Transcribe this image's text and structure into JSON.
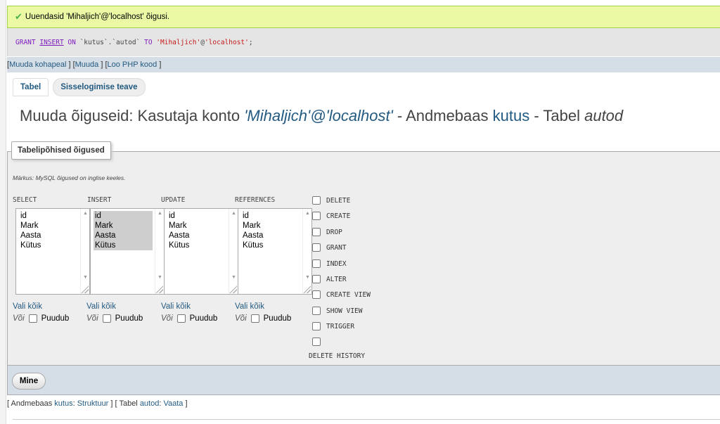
{
  "success_message": "Uuendasid 'Mihaljich'@'localhost' õigusi.",
  "sql": {
    "parts": [
      {
        "t": "GRANT",
        "c": "kw"
      },
      {
        "t": " ",
        "c": "plain"
      },
      {
        "t": "INSERT",
        "c": "kw u"
      },
      {
        "t": " ",
        "c": "plain"
      },
      {
        "t": "ON",
        "c": "kw"
      },
      {
        "t": " `kutus`.`autod` ",
        "c": "plain"
      },
      {
        "t": "TO",
        "c": "kw"
      },
      {
        "t": " ",
        "c": "plain"
      },
      {
        "t": "'Mihaljich'",
        "c": "str"
      },
      {
        "t": "@",
        "c": "plain"
      },
      {
        "t": "'localhost'",
        "c": "str"
      },
      {
        "t": ";",
        "c": "plain"
      }
    ]
  },
  "links": {
    "edit_inline": "Muuda kohapeal",
    "edit": "Muuda",
    "create_php": "Loo PHP kood"
  },
  "tabs": {
    "table": "Tabel",
    "login": "Sisselogimise teave"
  },
  "title": {
    "prefix": "Muuda õiguseid: Kasutaja konto ",
    "user": "'Mihaljich'@'localhost'",
    "db_label": " - Andmebaas ",
    "db": "kutus",
    "table_label": " - Tabel ",
    "table": "autod"
  },
  "fieldset": {
    "legend": "Tabelipõhised õigused",
    "note": "Märkus: MySQL õigused on inglise keeles."
  },
  "columns": {
    "select": "SELECT",
    "insert": "INSERT",
    "update": "UPDATE",
    "references": "REFERENCES",
    "fields": [
      "id",
      "Mark",
      "Aasta",
      "Kütus"
    ],
    "select_all": "Vali kõik",
    "or": "Või",
    "none": "Puudub"
  },
  "privileges": [
    "DELETE",
    "CREATE",
    "DROP",
    "GRANT",
    "INDEX",
    "ALTER",
    "CREATE VIEW",
    "SHOW VIEW",
    "TRIGGER"
  ],
  "delete_history": "DELETE HISTORY",
  "go_button": "Mine",
  "bottom": {
    "db_prefix": "Andmebaas",
    "db": "kutus",
    "structure": "Struktuur",
    "table_prefix": "Tabel",
    "table": "autod",
    "browse": "Vaata"
  },
  "colors": {
    "link": "#235a81",
    "success_bg": "#ebf8a4",
    "linkbar_bg": "#d5dde6"
  }
}
